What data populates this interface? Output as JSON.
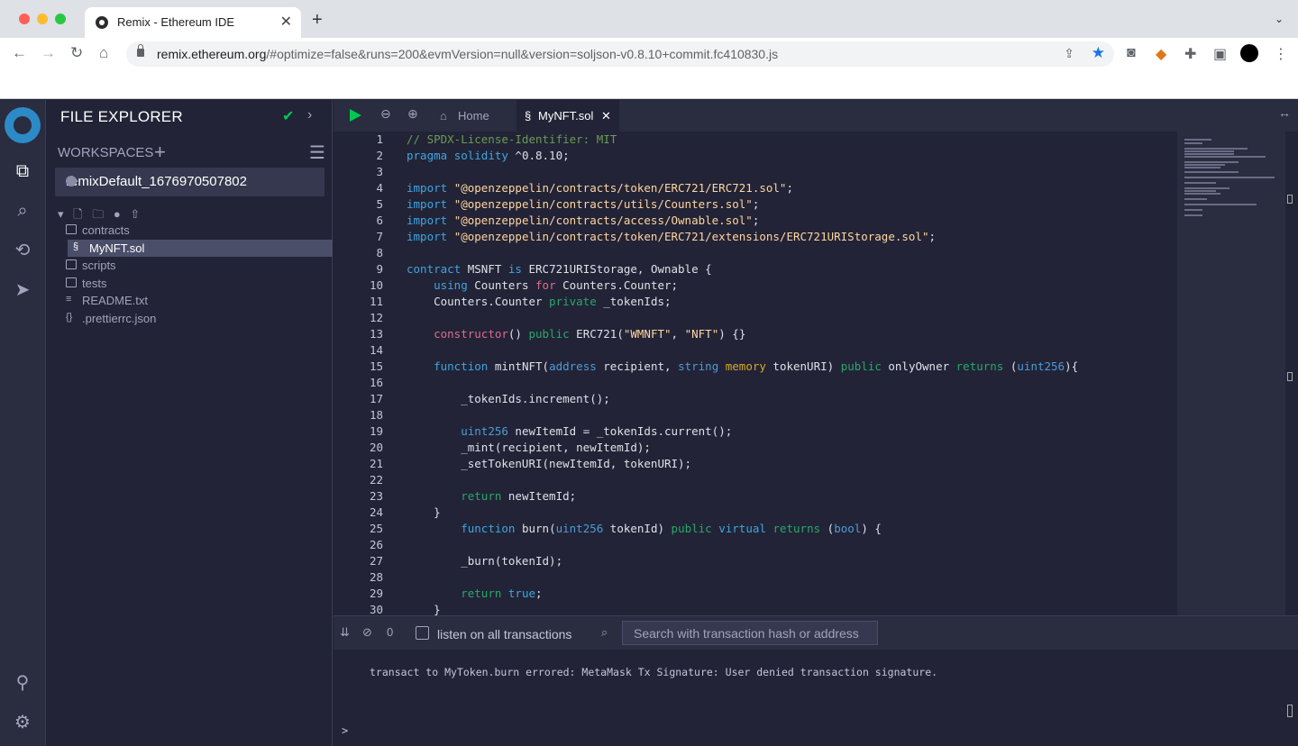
{
  "browser": {
    "tab_title": "Remix - Ethereum IDE",
    "url_domain": "remix.ethereum.org",
    "url_rest": "/#optimize=false&runs=200&evmVersion=null&version=soljson-v0.8.10+commit.fc410830.js"
  },
  "sidebar": {
    "title": "FILE EXPLORER",
    "workspaces_label": "WORKSPACES",
    "workspace_name": "remixDefault_1676970507802",
    "tree": [
      {
        "label": "contracts",
        "kind": "folder",
        "indent": 0
      },
      {
        "label": "MyNFT.sol",
        "kind": "sol",
        "indent": 1,
        "selected": true
      },
      {
        "label": "scripts",
        "kind": "folder",
        "indent": 0
      },
      {
        "label": "tests",
        "kind": "folder",
        "indent": 0
      },
      {
        "label": "README.txt",
        "kind": "file",
        "indent": 0
      },
      {
        "label": ".prettierrc.json",
        "kind": "json",
        "indent": 0
      }
    ]
  },
  "editor": {
    "tabs": [
      {
        "label": "Home"
      },
      {
        "label": "MyNFT.sol"
      }
    ],
    "code": [
      "<span class=\"cm\">// SPDX-License-Identifier: MIT</span>",
      "<span class=\"kw\">pragma</span> <span class=\"kw\">solidity</span> ^0.8.10;",
      "",
      "<span class=\"kw\">import</span> <span class=\"st\">\"@openzeppelin/contracts/token/ERC721/ERC721.sol\"</span>;",
      "<span class=\"kw\">import</span> <span class=\"st\">\"@openzeppelin/contracts/utils/Counters.sol\"</span>;",
      "<span class=\"kw\">import</span> <span class=\"st\">\"@openzeppelin/contracts/access/Ownable.sol\"</span>;",
      "<span class=\"kw\">import</span> <span class=\"st\">\"@openzeppelin/contracts/token/ERC721/extensions/ERC721URIStorage.sol\"</span>;",
      "",
      "<span class=\"kw\">contract</span> MSNFT <span class=\"kw\">is</span> ERC721URIStorage, Ownable {",
      "    <span class=\"kw\">using</span> Counters <span class=\"pk\">for</span> Counters.Counter;",
      "    Counters.Counter <span class=\"gr\">private</span> _tokenIds;",
      "",
      "    <span class=\"pk\">constructor</span>() <span class=\"gr\">public</span> ERC721(<span class=\"st\">\"WMNFT\"</span>, <span class=\"st\">\"NFT\"</span>) {}",
      "",
      "    <span class=\"kw\">function</span> mintNFT(<span class=\"ty\">address</span> recipient, <span class=\"ty\">string</span> <span class=\"ye\">memory</span> tokenURI) <span class=\"gr\">public</span> onlyOwner <span class=\"gr\">returns</span> (<span class=\"ty\">uint256</span>){",
      "",
      "        _tokenIds.increment();",
      "",
      "        <span class=\"ty\">uint256</span> newItemId = _tokenIds.current();",
      "        _mint(recipient, newItemId);",
      "        _setTokenURI(newItemId, tokenURI);",
      "",
      "        <span class=\"gr\">return</span> newItemId;",
      "    }",
      "        <span class=\"kw\">function</span> burn(<span class=\"ty\">uint256</span> tokenId) <span class=\"gr\">public</span> <span class=\"kw\">virtual</span> <span class=\"gr\">returns</span> (<span class=\"ty\">bool</span>) {",
      "",
      "        _burn(tokenId);",
      "",
      "        <span class=\"gr\">return</span> <span class=\"kw\">true</span>;",
      "    }"
    ]
  },
  "terminal": {
    "count": "0",
    "listen_label": "listen on all transactions",
    "search_placeholder": "Search with transaction hash or address",
    "message": "transact to MyToken.burn errored: MetaMask Tx Signature: User denied transaction signature.",
    "prompt": ">"
  },
  "colors": {
    "accent": "#2c8ac7",
    "success": "#00c851",
    "bg": "#222336"
  }
}
